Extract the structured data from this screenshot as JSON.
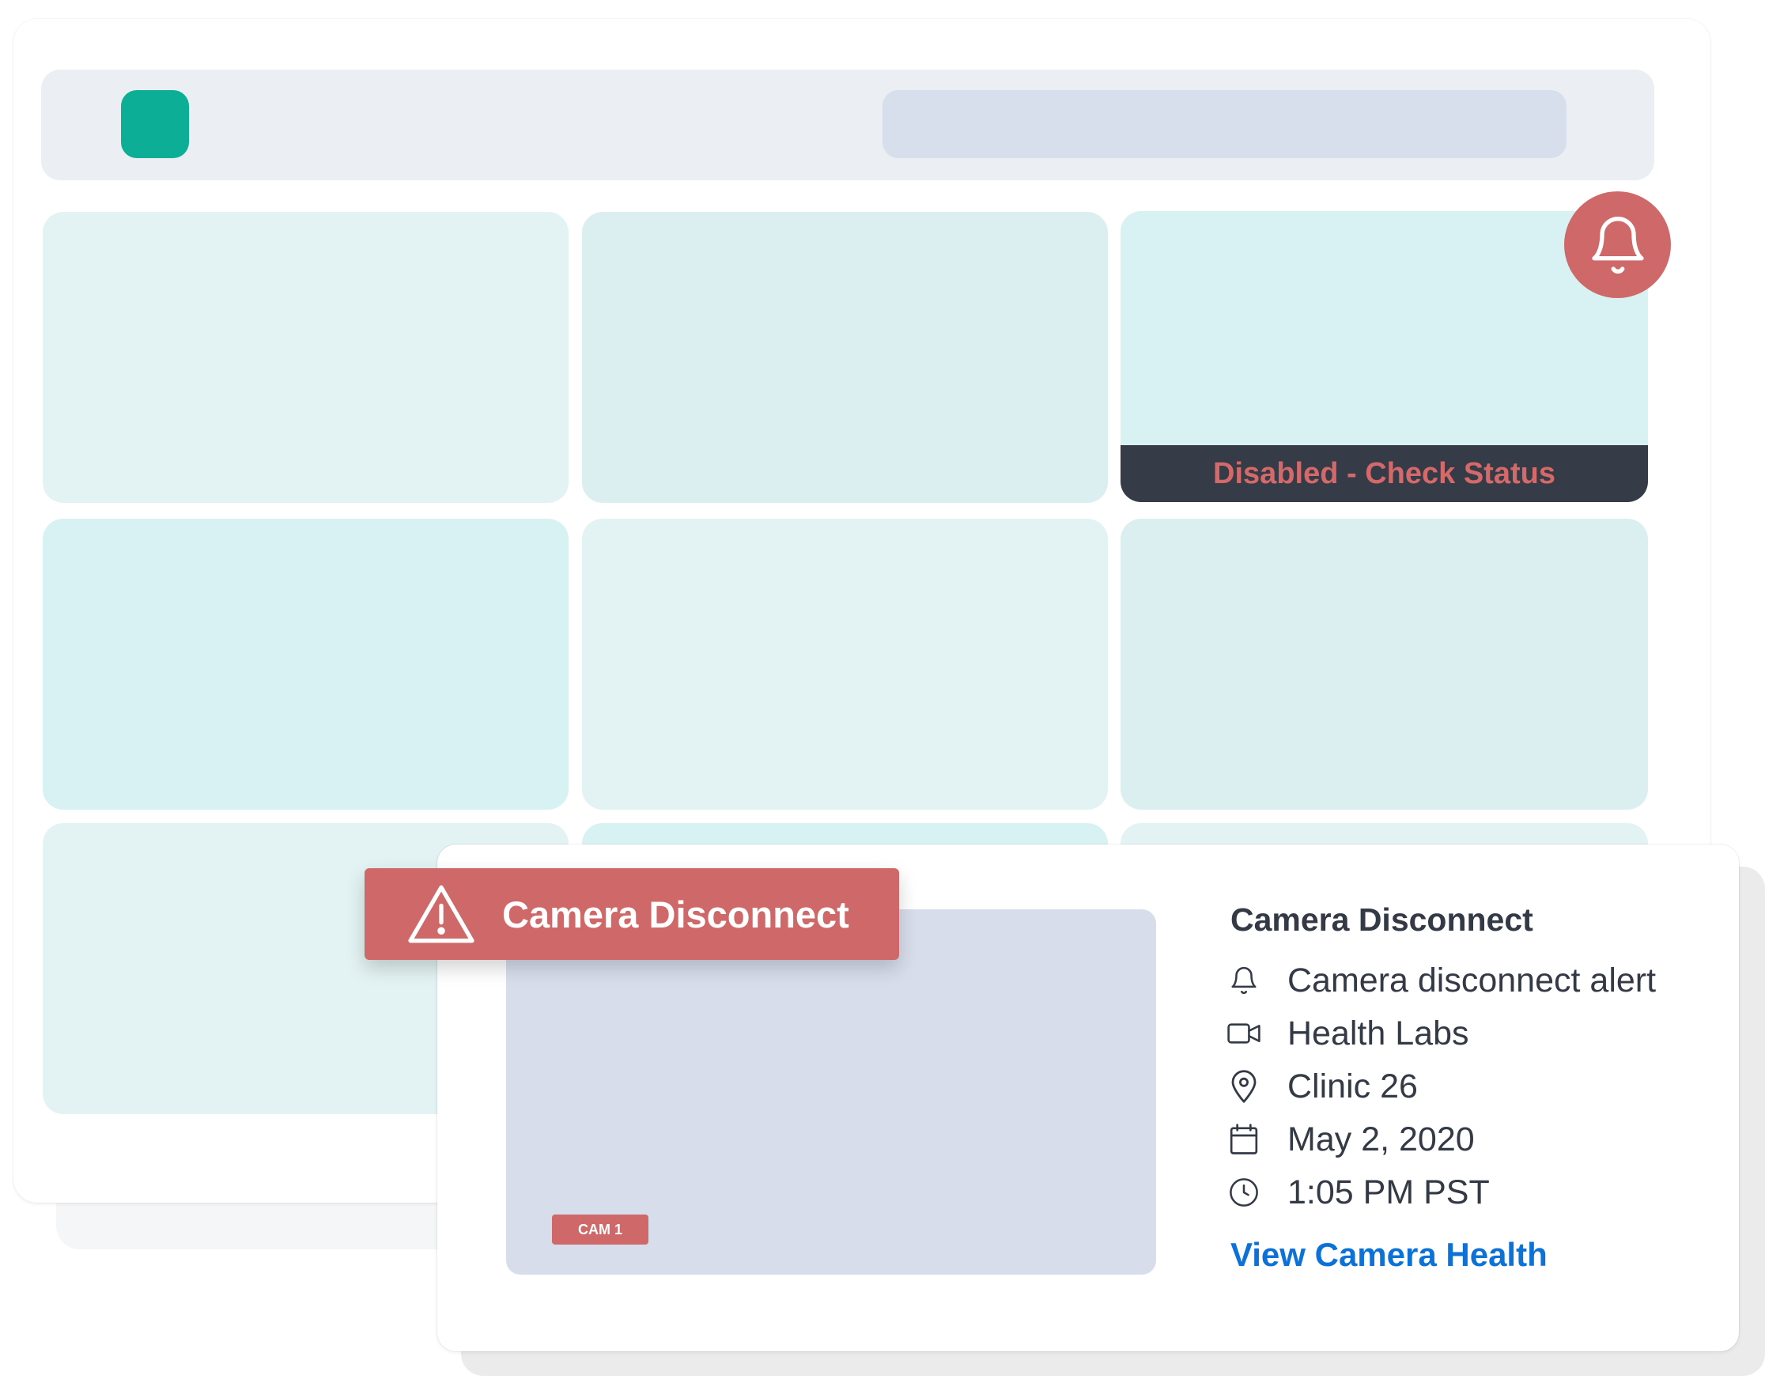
{
  "dashboard": {
    "status_text": "Disabled - Check Status"
  },
  "alert": {
    "banner_label": "Camera Disconnect",
    "camera_tag": "CAM 1",
    "title": "Camera Disconnect",
    "details": [
      {
        "icon": "bell-icon",
        "text": "Camera disconnect alert"
      },
      {
        "icon": "video-camera-icon",
        "text": "Health Labs"
      },
      {
        "icon": "location-pin-icon",
        "text": "Clinic 26"
      },
      {
        "icon": "calendar-icon",
        "text": "May 2, 2020"
      },
      {
        "icon": "clock-icon",
        "text": "1:05 PM PST"
      }
    ],
    "link_label": "View Camera Health"
  },
  "colors": {
    "brand_teal": "#0caf96",
    "alert_red": "#cf6868",
    "link_blue": "#0d72d8",
    "status_bar_dark": "#363c47",
    "text_dark": "#333a45"
  }
}
